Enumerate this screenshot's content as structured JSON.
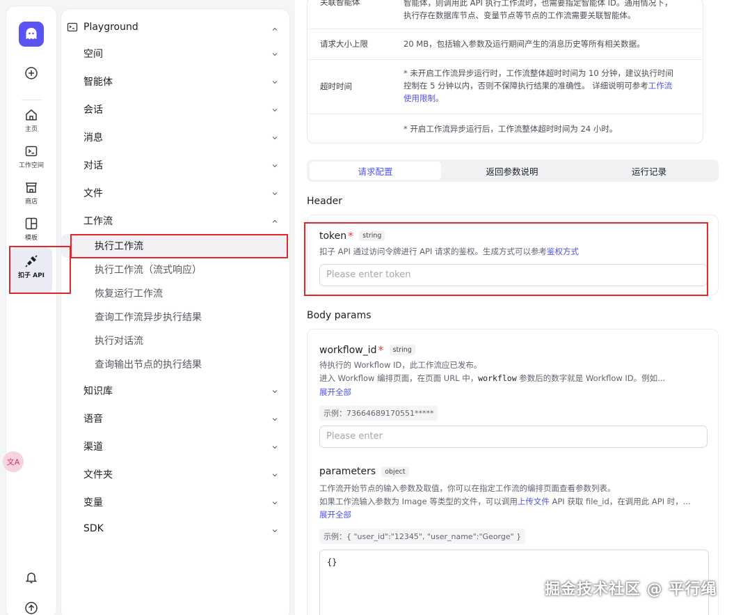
{
  "rail": {
    "items": [
      {
        "label": "主页",
        "icon": "home-icon"
      },
      {
        "label": "工作空间",
        "icon": "terminal-icon"
      },
      {
        "label": "商店",
        "icon": "store-icon"
      },
      {
        "label": "模板",
        "icon": "template-icon"
      },
      {
        "label": "扣子 API",
        "icon": "plug-icon"
      }
    ],
    "add_icon": "plus-circle-icon",
    "bell_icon": "bell-icon",
    "upgrade_icon": "arrow-up-circle-icon",
    "translate_icon": "translate-icon",
    "brand_color": "#5b54f5"
  },
  "nav": {
    "head": "Playground",
    "items": [
      "空间",
      "智能体",
      "会话",
      "消息",
      "对话",
      "文件",
      "工作流"
    ],
    "workflow_children": [
      "执行工作流",
      "执行工作流（流式响应）",
      "恢复运行工作流",
      "查询工作流异步执行结果",
      "执行对话流",
      "查询输出节点的执行结果"
    ],
    "items_after": [
      "知识库",
      "语音",
      "渠道",
      "文件夹",
      "变量",
      "SDK"
    ]
  },
  "info_table": {
    "row0_label": "关联智能体",
    "row0_line1": "智能体，则调用此 API 执行工作流时，也需要指定智能体 ID。通用情况下，",
    "row0_line2": "执行存在数据库节点、变量节点等节点的工作流需要关联智能体。",
    "row1_label": "请求大小上限",
    "row1_value": "20 MB，包括输入参数及运行期间产生的消息历史等所有相关数据。",
    "row2_label": "超时时间",
    "row2_line1": "* 未开启工作流异步运行时，工作流整体超时时间为 10 分钟，建议执行时间",
    "row2_line2a": "控制在 5 分钟以内，否则不保障执行结果的准确性。 详细说明可参考",
    "row2_link1": "工作流",
    "row2_link2": "使用限制",
    "row2_end": "。",
    "row3_value": "* 开启工作流异步运行后，工作流整体超时时间为 24 小时。"
  },
  "tabs": [
    "请求配置",
    "返回参数说明",
    "运行记录"
  ],
  "header_section": "Header",
  "token": {
    "name": "token",
    "type": "string",
    "desc": "扣子 API 通过访问令牌进行 API 请求的鉴权。生成方式可以参考",
    "desc_link": "鉴权方式",
    "placeholder": "Please enter token"
  },
  "body_section": "Body params",
  "workflow_id": {
    "name": "workflow_id",
    "type": "string",
    "desc1": "待执行的 Workflow ID，此工作流应已发布。",
    "desc2a": "进入 Workflow 编排页面，在页面 URL 中，",
    "desc2_code": "workflow",
    "desc2b": " 参数后的数字就是 Workflow ID。例如...",
    "expand": "展开全部",
    "example": "示例：73664689170551*****",
    "placeholder": "Please enter"
  },
  "parameters": {
    "name": "parameters",
    "type": "object",
    "desc1": "工作流开始节点的输入参数及取值，你可以在指定工作流的编排页面查看参数列表。",
    "desc2a": "如果工作流输入参数为 Image 等类型的文件，可以调用",
    "desc2_link": "上传文件",
    "desc2b": " API 获取 file_id，在调用此 API 时，...",
    "expand": "展开全部",
    "example": "示例：{ \"user_id\":\"12345\", \"user_name\":\"George\" }",
    "value": "{}"
  },
  "watermark": "掘金技术社区 @ 平行绳"
}
